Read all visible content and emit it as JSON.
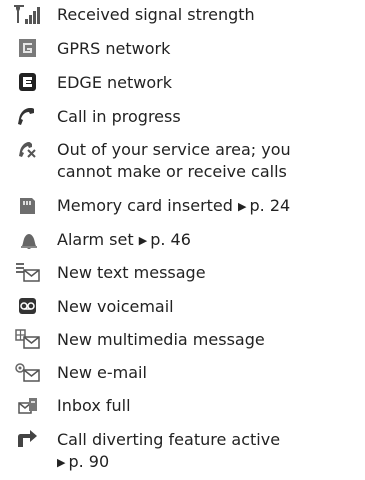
{
  "items": [
    {
      "icon": "signal-strength-icon",
      "lines": [
        "Received signal strength"
      ]
    },
    {
      "icon": "gprs-network-icon",
      "lines": [
        "GPRS network"
      ]
    },
    {
      "icon": "edge-network-icon",
      "lines": [
        "EDGE network"
      ]
    },
    {
      "icon": "call-in-progress-icon",
      "lines": [
        "Call in progress"
      ]
    },
    {
      "icon": "out-of-service-icon",
      "lines": [
        "Out of your service area; you",
        "cannot make or receive calls"
      ]
    },
    {
      "icon": "memory-card-icon",
      "lines": [
        "Memory card inserted"
      ],
      "ref": "p. 24"
    },
    {
      "icon": "alarm-icon",
      "lines": [
        "Alarm set"
      ],
      "ref": "p. 46"
    },
    {
      "icon": "text-message-icon",
      "lines": [
        "New text message"
      ]
    },
    {
      "icon": "voicemail-icon",
      "lines": [
        "New voicemail"
      ]
    },
    {
      "icon": "multimedia-message-icon",
      "lines": [
        "New multimedia message"
      ]
    },
    {
      "icon": "email-icon",
      "lines": [
        "New e-mail"
      ]
    },
    {
      "icon": "inbox-full-icon",
      "lines": [
        "Inbox full"
      ]
    },
    {
      "icon": "call-divert-icon",
      "lines": [
        "Call diverting feature active"
      ],
      "ref": "p. 90",
      "ref_own_line": true
    }
  ],
  "ref_arrow": "▶"
}
